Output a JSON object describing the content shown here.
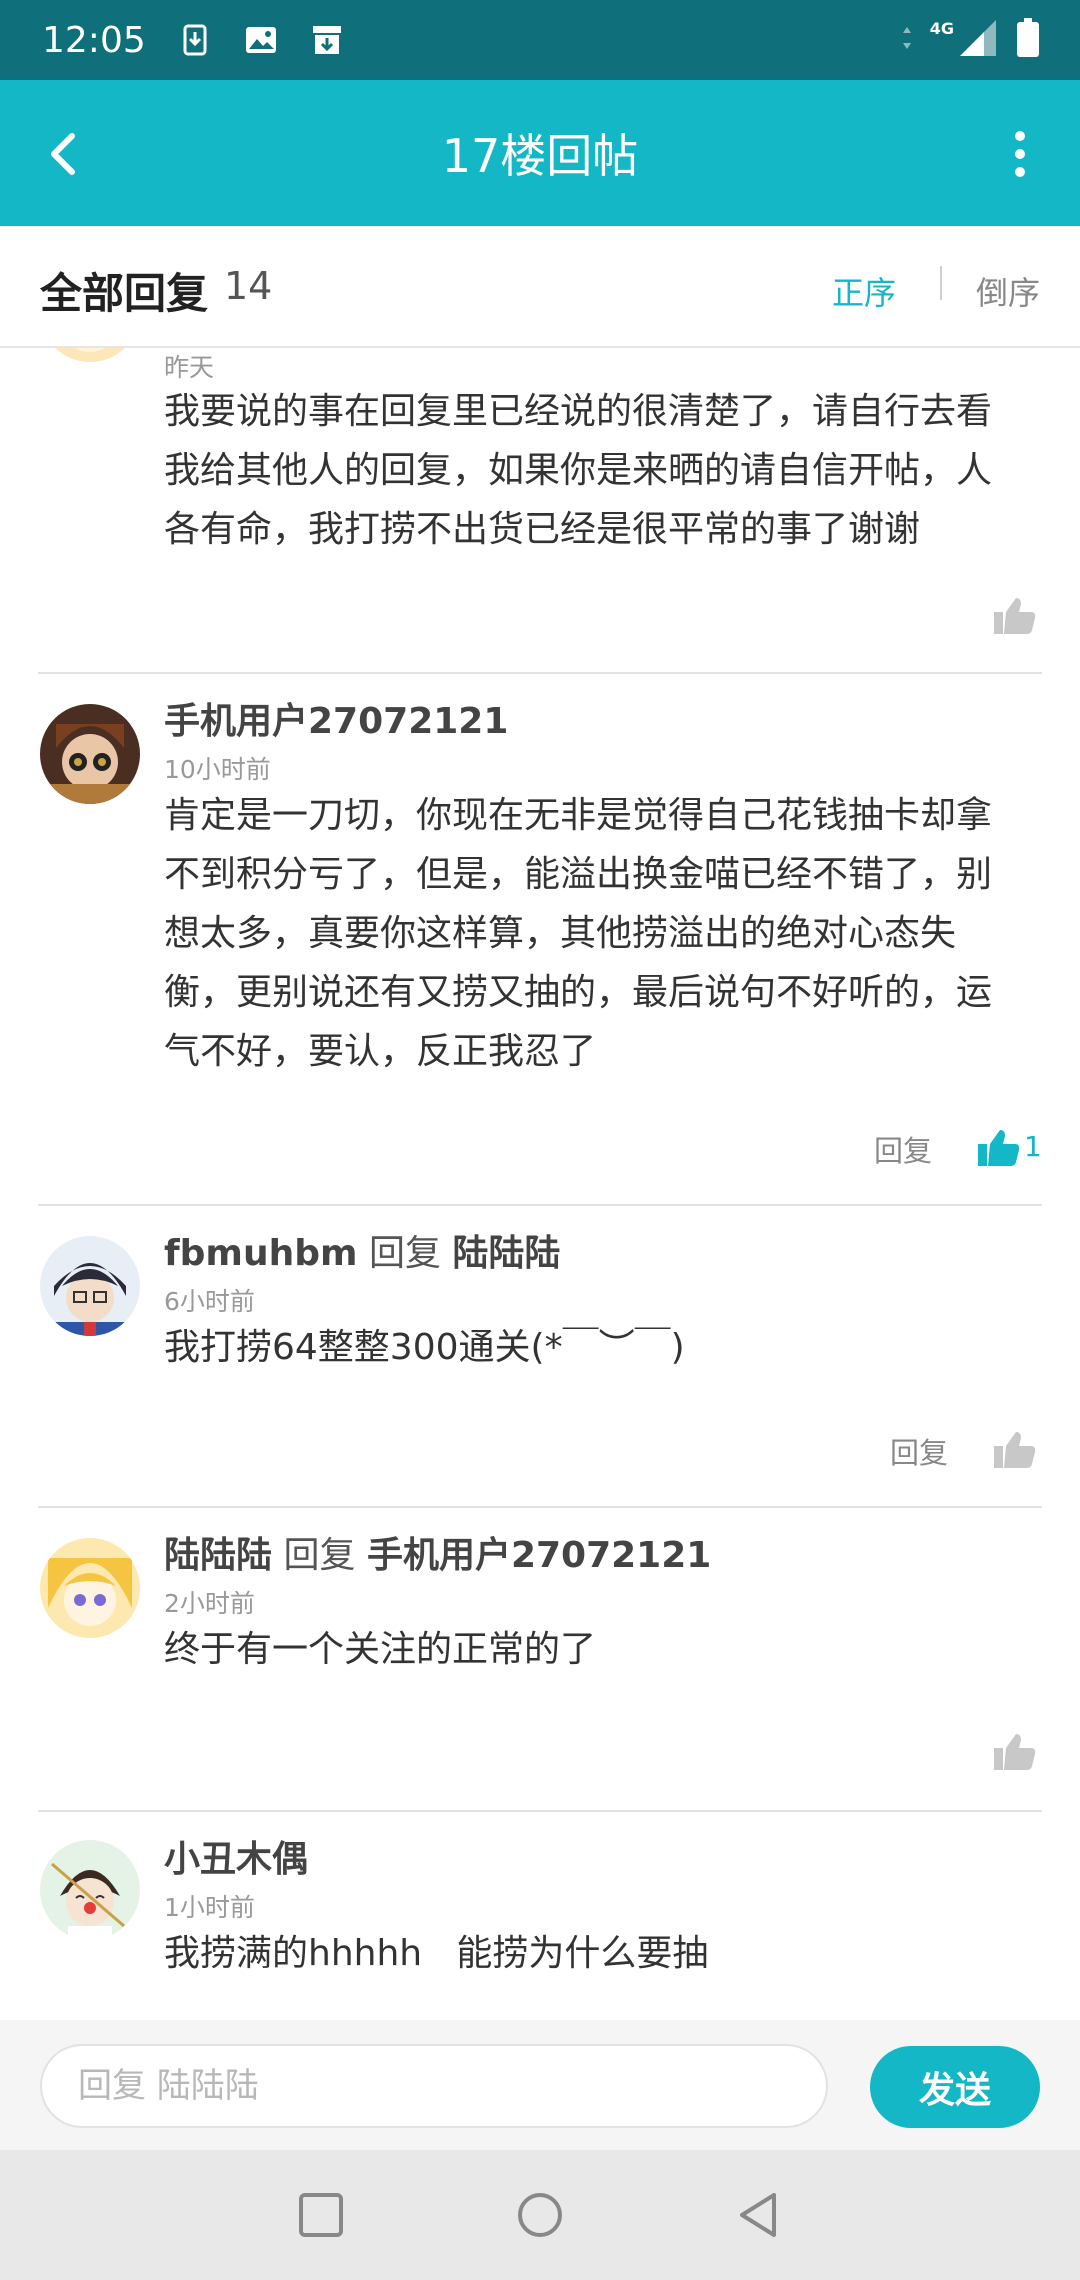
{
  "status_bar": {
    "time": "12:05",
    "network": "4G"
  },
  "header": {
    "title": "17楼回帖"
  },
  "summary": {
    "title": "全部回复",
    "count": "14",
    "sort_asc": "正序",
    "sort_desc": "倒序"
  },
  "replies": [
    {
      "name": "",
      "reply_word": "",
      "reply_to": "",
      "time": "昨天",
      "content": "我要说的事在回复里已经说的很清楚了，请自行去看我给其他人的回复，如果你是来晒的请自信开帖，人各有命，我打捞不出货已经是很平常的事了谢谢",
      "reply_label": "",
      "likes": ""
    },
    {
      "name": "手机用户27072121",
      "reply_word": "",
      "reply_to": "",
      "time": "10小时前",
      "content": "肯定是一刀切，你现在无非是觉得自己花钱抽卡却拿不到积分亏了，但是，能溢出换金喵已经不错了，别想太多，真要你这样算，其他捞溢出的绝对心态失衡，更别说还有又捞又抽的，最后说句不好听的，运气不好，要认，反正我忍了",
      "reply_label": "回复",
      "likes": "1"
    },
    {
      "name": "fbmuhbm",
      "reply_word": "回复",
      "reply_to": "陆陆陆",
      "time": "6小时前",
      "content": "我打捞64整整300通关(*￣︶￣)",
      "reply_label": "回复",
      "likes": ""
    },
    {
      "name": "陆陆陆",
      "reply_word": "回复",
      "reply_to": "手机用户27072121",
      "time": "2小时前",
      "content": "终于有一个关注的正常的了",
      "reply_label": "",
      "likes": ""
    },
    {
      "name": "小丑木偶",
      "reply_word": "",
      "reply_to": "",
      "time": "1小时前",
      "content": "我捞满的hhhhh   能捞为什么要抽",
      "reply_label": "",
      "likes": ""
    }
  ],
  "input": {
    "placeholder": "回复 陆陆陆",
    "send_label": "发送"
  },
  "colors": {
    "accent": "#14b7c5",
    "status_bar": "#0f6f7a",
    "like_active": "#14b7c5",
    "like_inactive": "#c8c8c8"
  },
  "icons": [
    "back-arrow-icon",
    "more-vertical-icon",
    "thumb-up-icon",
    "square-nav-icon",
    "circle-nav-icon",
    "triangle-back-nav-icon"
  ]
}
